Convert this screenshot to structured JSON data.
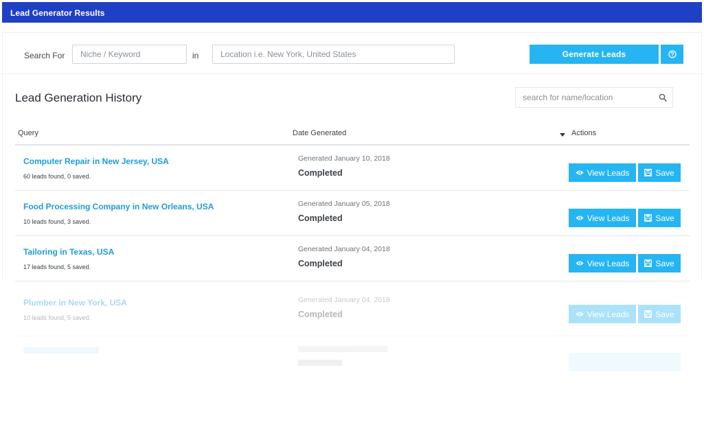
{
  "header": {
    "title": "Lead Generator Results"
  },
  "search": {
    "label_for": "Search For",
    "niche_placeholder": "Niche / Keyword",
    "label_in": "in",
    "location_placeholder": "Location i.e. New York, United States",
    "generate_label": "Generate Leads",
    "help_icon": "question-circle-icon"
  },
  "history": {
    "title": "Lead Generation History",
    "search_placeholder": "search for name/location",
    "columns": {
      "query": "Query",
      "date": "Date Generated",
      "actions": "Actions"
    },
    "view_label": "View Leads",
    "save_label": "Save",
    "rows": [
      {
        "query": "Computer Repair in New Jersey, USA",
        "summary": "60 leads found, 0 saved.",
        "generated": "Generated January 10, 2018",
        "status": "Completed"
      },
      {
        "query": "Food Processing Company in New Orleans, USA",
        "summary": "10 leads found, 3 saved.",
        "generated": "Generated January 05, 2018",
        "status": "Completed"
      },
      {
        "query": "Tailoring in Texas, USA",
        "summary": "17 leads found, 5 saved.",
        "generated": "Generated January 04, 2018",
        "status": "Completed"
      },
      {
        "query": "Plumber in New York, USA",
        "summary": "10 leads found, 5 saved.",
        "generated": "Generated January 04, 2018",
        "status": "Completed"
      }
    ]
  },
  "colors": {
    "header_bg": "#1f3fc4",
    "accent": "#25b5f2",
    "link": "#1e9bd6"
  }
}
